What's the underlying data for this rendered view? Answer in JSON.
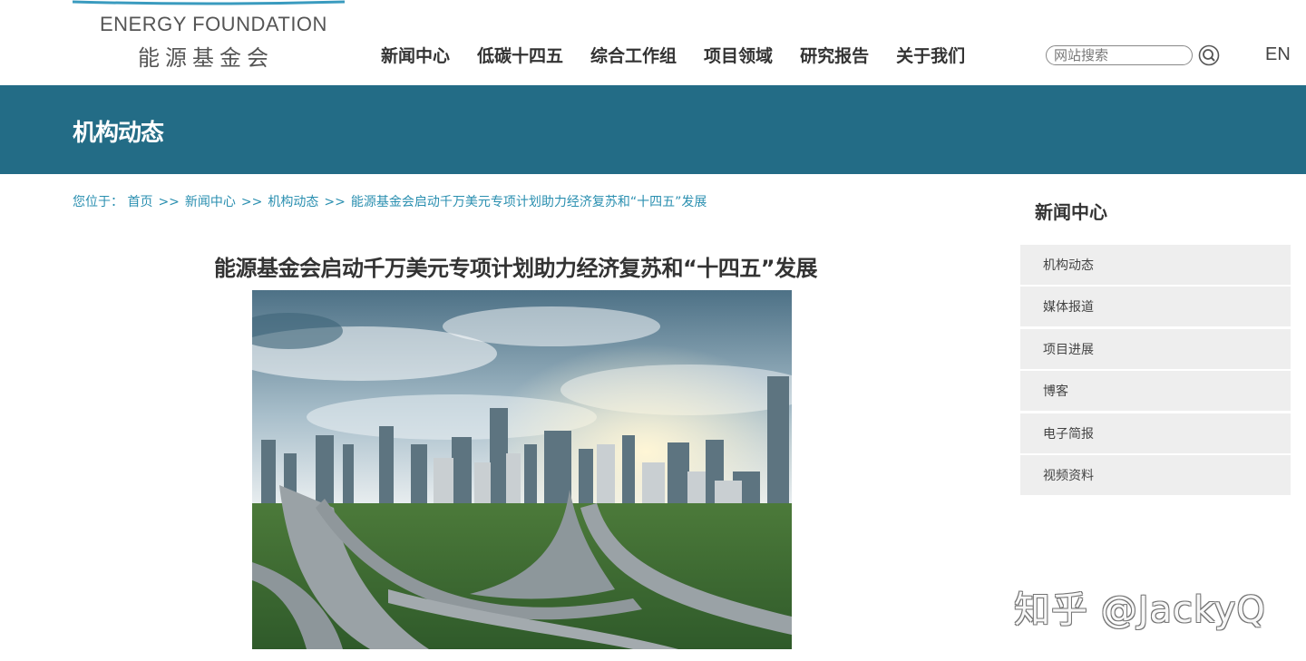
{
  "logo": {
    "en": "ENERGY FOUNDATION",
    "cn": "能源基金会"
  },
  "nav": [
    "新闻中心",
    "低碳十四五",
    "综合工作组",
    "项目领域",
    "研究报告",
    "关于我们"
  ],
  "search": {
    "placeholder": "网站搜索"
  },
  "lang": "EN",
  "banner": {
    "title": "机构动态"
  },
  "breadcrumb": {
    "prefix": "您位于：",
    "items": [
      "首页",
      "新闻中心",
      "机构动态",
      "能源基金会启动千万美元专项计划助力经济复苏和“十四五”发展"
    ],
    "separator": ">>"
  },
  "article": {
    "title": "能源基金会启动千万美元专项计划助力经济复苏和“十四五”发展"
  },
  "sidebar": {
    "title": "新闻中心",
    "items": [
      "机构动态",
      "媒体报道",
      "项目进展",
      "博客",
      "电子简报",
      "视频资料"
    ]
  },
  "watermark": "知乎 @JackyQ",
  "colors": {
    "banner": "#236c86",
    "breadcrumb": "#2a8fb0",
    "sidebar_item_bg": "#eeeeee"
  }
}
